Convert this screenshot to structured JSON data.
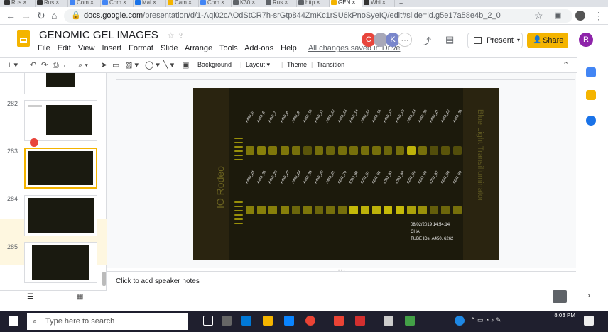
{
  "browser": {
    "tabs": [
      {
        "label": "Rus",
        "color": "#333333"
      },
      {
        "label": "Rus",
        "color": "#333333"
      },
      {
        "label": "Com",
        "color": "#4285f4"
      },
      {
        "label": "Com",
        "color": "#4285f4"
      },
      {
        "label": "Mai",
        "color": "#1a73e8"
      },
      {
        "label": "Cam",
        "color": "#f4b400"
      },
      {
        "label": "Com",
        "color": "#4285f4"
      },
      {
        "label": "K30",
        "color": "#5f6368"
      },
      {
        "label": "Rus",
        "color": "#5f6368"
      },
      {
        "label": "http",
        "color": "#5f6368"
      },
      {
        "label": "GEN",
        "color": "#f4b400"
      },
      {
        "label": "Whi",
        "color": "#333333"
      }
    ],
    "url_host": "docs.google.com",
    "url_path": "/presentation/d/1-Aql02cAOdStCR7h-srGtp844ZmKc1rSU6kPnoSyeIQ/edit#slide=id.g5e17a58e4b_2_0"
  },
  "doc": {
    "title": "GENOMIC GEL IMAGES",
    "menu": [
      "File",
      "Edit",
      "View",
      "Insert",
      "Format",
      "Slide",
      "Arrange",
      "Tools",
      "Add-ons",
      "Help"
    ],
    "save_status": "All changes saved in Drive",
    "present_label": "Present",
    "share_label": "Share",
    "user_initial": "R",
    "collaborators": [
      {
        "initial": "C",
        "color": "#e8453c"
      },
      {
        "initial": "",
        "color": "#a8a8b8"
      },
      {
        "initial": "K",
        "color": "#7986cb"
      }
    ]
  },
  "toolbar": {
    "background": "Background",
    "layout": "Layout",
    "theme": "Theme",
    "transition": "Transition"
  },
  "slides": [
    {
      "number": "282"
    },
    {
      "number": "283"
    },
    {
      "number": "284"
    },
    {
      "number": "285"
    }
  ],
  "gel": {
    "top_labels": [
      "A450_5",
      "A450_6",
      "A450_7",
      "A450_8",
      "A450_9",
      "A450_10",
      "A450_11",
      "A450_12",
      "A450_13",
      "A450_14",
      "A450_15",
      "A450_16",
      "A450_17",
      "A450_18",
      "A450_19",
      "A450_20",
      "A450_21",
      "A450_22",
      "A450_23"
    ],
    "bottom_labels": [
      "A450_24",
      "A450_25",
      "A450_26",
      "A450_27",
      "A450_28",
      "A450_29",
      "A450_30",
      "A450_31",
      "6262_79",
      "6262_80",
      "6262_81",
      "6262_82",
      "6262_83",
      "6262_84",
      "6262_85",
      "6262_86",
      "6262_87",
      "6262_88",
      "6262_89"
    ],
    "watermark_left": "IO Rodeo",
    "watermark_right": "Blue Light Transilluminator",
    "info_date": "08/02/2019 14:54:14",
    "info_name": "CHAI",
    "info_tubes": "TUBE IDs: A450, 6262"
  },
  "notes": {
    "placeholder": "Click to add speaker notes"
  },
  "taskbar": {
    "search_placeholder": "Type here to search",
    "time": "8:03 PM"
  }
}
